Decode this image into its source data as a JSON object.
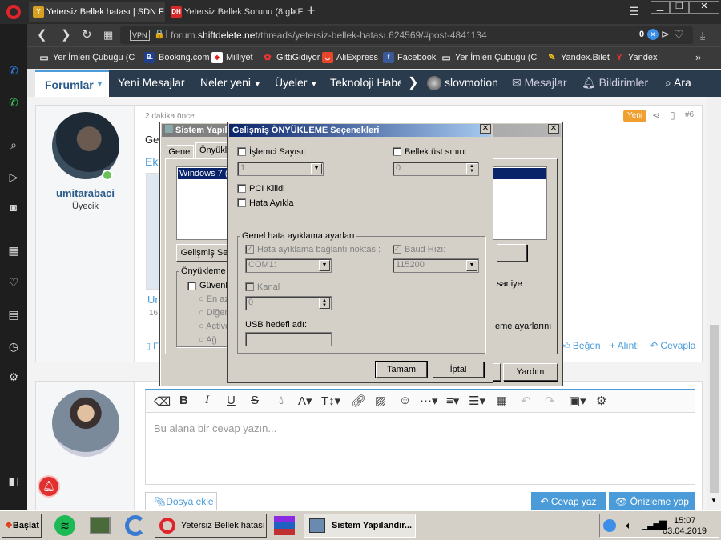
{
  "browser": {
    "tabs": [
      {
        "title": "Yetersiz Bellek hatası | SDN F",
        "fav": "Y",
        "active": true
      },
      {
        "title": "Yetersiz Bellek Sorunu (8 gb F",
        "fav": "DH",
        "active": false
      }
    ],
    "new_tab": "+",
    "url_prefix": "forum.",
    "url_domain": "shiftdelete.net",
    "url_path": "/threads/yetersiz-bellek-hatası.624569/#post-4841134",
    "vpn": "VPN",
    "ad_count": "0",
    "bookmarks": [
      {
        "label": "Yer İmleri Çubuğu (Chr",
        "icon": "folder-icon"
      },
      {
        "label": "Booking.com",
        "icon": "booking-icon"
      },
      {
        "label": "Milliyet",
        "icon": "milliyet-icon"
      },
      {
        "label": "GittiGidiyor",
        "icon": "gittigidiyor-icon"
      },
      {
        "label": "AliExpress",
        "icon": "aliexpress-icon"
      },
      {
        "label": "Facebook",
        "icon": "facebook-icon"
      },
      {
        "label": "Yer İmleri Çubuğu (Chr",
        "icon": "folder-icon"
      },
      {
        "label": "Yandex.Bilet",
        "icon": "yandex-bilet-icon"
      },
      {
        "label": "Yandex",
        "icon": "yandex-icon"
      }
    ]
  },
  "site_nav": {
    "forumlar": "Forumlar",
    "items": [
      "Yeni Mesajlar",
      "Neler yeni",
      "Üyeler",
      "Teknoloji Habe"
    ],
    "user": "slovmotion",
    "mesajlar": "Mesajlar",
    "bildirimler": "Bildirimler",
    "ara": "Ara"
  },
  "post": {
    "time": "2 dakika önce",
    "badge": "Yeni",
    "number": "#6",
    "username": "umitarabaci",
    "role": "Üyecik",
    "text_frag": "Ge",
    "link_frag": "Ekl",
    "attach_frag": "Ur",
    "attach_size": "16",
    "begen": "Beğen",
    "alinti": "+ Alıntı",
    "cevapla": "Cevapla"
  },
  "reply": {
    "placeholder": "Bu alana bir cevap yazın...",
    "dosya_ekle": "Dosya ekle",
    "cevap_yaz": "Cevap yaz",
    "onizleme": "Önizleme yap"
  },
  "sysconfig": {
    "title": "Sistem Yapılandırma",
    "tabs": [
      "Genel",
      "Önyükleme"
    ],
    "list_item": "Windows 7 (C:",
    "gelismis_btn": "Gelişmiş Se",
    "onyukleme_group": "Önyükleme Se",
    "guvenli": "Güvenli",
    "radios": [
      "En az",
      "Diğer",
      "Active",
      "Ağ"
    ],
    "saniye": "saniye",
    "ayarlar_frag": "eme ayarlarını",
    "yardim": "Yardım"
  },
  "advanced": {
    "title": "Gelişmiş ÖNYÜKLEME Seçenekleri",
    "islemci_label": "İşlemci Sayısı:",
    "islemci_value": "1",
    "bellek_label": "Bellek üst sınırı:",
    "bellek_value": "0",
    "pci": "PCI Kilidi",
    "hata_ayikla": "Hata Ayıkla",
    "group_label": "Genel hata ayıklama ayarları",
    "baglanti_label": "Hata ayıklama bağlantı noktası:",
    "baglanti_value": "COM1:",
    "baud_label": "Baud Hızı:",
    "baud_value": "115200",
    "kanal_label": "Kanal",
    "kanal_value": "0",
    "usb_label": "USB hedefi adı:",
    "tamam": "Tamam",
    "iptal": "İptal"
  },
  "taskbar": {
    "start": "Başlat",
    "tasks": [
      "Yetersiz Bellek hatası ...",
      "Sistem Yapılandır..."
    ],
    "time": "15:07",
    "date": "03.04.2019"
  },
  "colors": {
    "site_nav": "#2a3b4d",
    "accent_blue": "#4a9bd8",
    "badge_orange": "#f0a030",
    "title_active": "#0a246a"
  }
}
